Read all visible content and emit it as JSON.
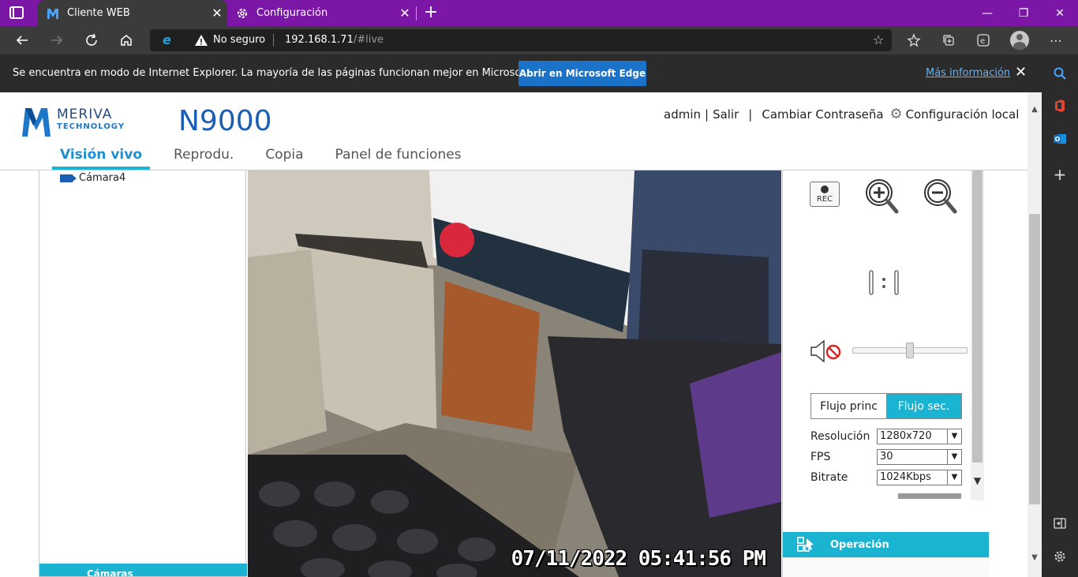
{
  "browser": {
    "tabs": [
      {
        "title": "Cliente WEB",
        "active": true
      },
      {
        "title": "Configuración",
        "active": false
      }
    ],
    "window_controls": {
      "minimize": "—",
      "restore": "❐",
      "close": "✕"
    },
    "address": {
      "security_label": "No seguro",
      "url_host": "192.168.1.71",
      "url_path": "/#live"
    },
    "ie_notice": {
      "text": "Se encuentra en modo de Internet Explorer. La mayoría de las páginas funcionan mejor en Microsoft Edge.",
      "button": "Abrir en Microsoft Edge",
      "link": "Más información"
    },
    "accent_color": "#7b16a6"
  },
  "app": {
    "brand_name": "MERIVA",
    "brand_sub": "TECHNOLOGY",
    "model": "N9000",
    "user": "admin",
    "logout": "Salir",
    "change_password": "Cambiar Contraseña",
    "local_config": "Configuración local",
    "nav": [
      {
        "label": "Visión vivo",
        "active": true
      },
      {
        "label": "Reprodu."
      },
      {
        "label": "Copia"
      },
      {
        "label": "Panel de funciones"
      }
    ],
    "camera_list": [
      {
        "label": "Cámara4"
      }
    ],
    "left_footer": "Cámaras",
    "video": {
      "osd_timestamp": "07/11/2022 05:41:56 PM"
    },
    "controls": {
      "rec_label": "REC",
      "stream_tabs": [
        {
          "label": "Flujo princ",
          "active": false
        },
        {
          "label": "Flujo sec.",
          "active": true
        }
      ],
      "fields": [
        {
          "label": "Resolución",
          "value": "1280x720"
        },
        {
          "label": "FPS",
          "value": "30"
        },
        {
          "label": "Bitrate",
          "value": "1024Kbps"
        }
      ],
      "volume_level": 0.5
    },
    "operation_label": "Operación",
    "accent_color": "#1ab3d1",
    "brand_color": "#1a5fb4"
  }
}
